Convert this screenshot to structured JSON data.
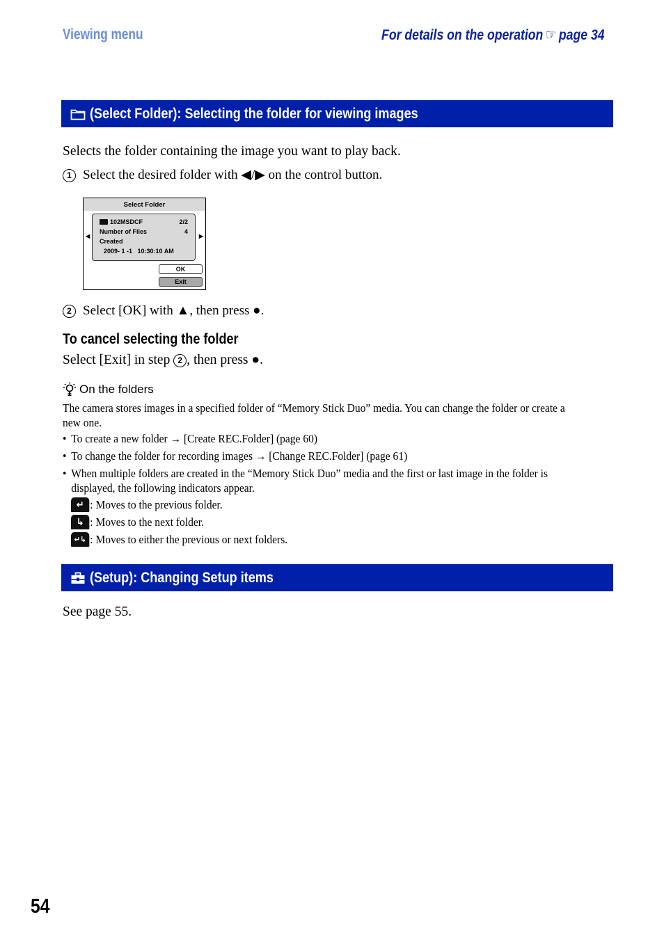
{
  "header": {
    "section": "Viewing menu",
    "details_prefix": "For details on the operation",
    "details_symbol": "☞",
    "details_page": "page 34"
  },
  "section_select_folder": {
    "title": "(Select Folder): Selecting the folder for viewing images",
    "icon": "folder-icon",
    "intro": "Selects the folder containing the image you want to play back.",
    "step1_num": "1",
    "step1_text": "Select the desired folder with ◀/▶ on the control button.",
    "screen": {
      "title": "Select Folder",
      "folder_name": "102MSDCF",
      "folder_index": "2/2",
      "files_label": "Number of Files",
      "files_value": "4",
      "created_label": "Created",
      "created_value": "2009- 1 -1   10:30:10 AM",
      "left_arrow": "◀",
      "right_arrow": "▶",
      "ok_label": "OK",
      "exit_label": "Exit"
    },
    "step2_num": "2",
    "step2_text": "Select [OK] with ▲, then press ●.",
    "cancel_heading": "To cancel selecting the folder",
    "cancel_pre": "Select [Exit] in step",
    "cancel_num": "2",
    "cancel_post": ", then press ●."
  },
  "tip": {
    "icon": "lightbulb-icon",
    "title": "On the folders",
    "body": "The camera stores images in a specified folder of “Memory Stick Duo” media. You can change the folder or create a new one.",
    "bullets": [
      "To create a new folder → [Create REC.Folder] (page 60)",
      "To change the folder for recording images → [Change REC.Folder] (page 61)",
      "When multiple folders are created in the “Memory Stick Duo” media and the first or last image in the folder is displayed, the following indicators appear."
    ],
    "indicators": [
      {
        "icon": "previous-folder-icon",
        "glyph": "↵",
        "text": ": Moves to the previous folder."
      },
      {
        "icon": "next-folder-icon",
        "glyph": "↳",
        "text": ": Moves to the next folder."
      },
      {
        "icon": "either-folder-icon",
        "glyph": "↵↳",
        "text": ": Moves to either the previous or next folders."
      }
    ]
  },
  "section_setup": {
    "title": "(Setup): Changing Setup items",
    "icon": "toolbox-icon",
    "body": "See page 55."
  },
  "page_number": "54"
}
